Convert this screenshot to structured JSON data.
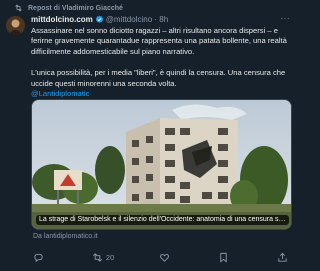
{
  "repost": {
    "icon": "repost-icon",
    "text": "Repost di Vladimiro Giacché"
  },
  "author": {
    "display_name": "mittdolcino.com",
    "verified_icon": "verified-badge-icon",
    "handle_time": "@mittdolcino · 8h"
  },
  "tweet": {
    "paragraph1": "Assassinare nel sonno diciotto ragazzi – altri risultano ancora dispersi – e ferirne gravemente quarantadue rappresenta una patata bollente, una realtà difficilmente addomesticabile sul piano narrativo.",
    "paragraph2": "L'unica possibilità, per i media \"liberi\", è quindi la censura. Una censura che uccide questi minorenni una seconda volta.",
    "mention": "@Lantidiplomatic"
  },
  "card": {
    "headline": "La strage di Starobelsk e il silenzio dell'Occidente: anatomia di una censura sel...",
    "source": "Da lantidiplomatico.it"
  },
  "actions": {
    "reply_icon": "reply-icon",
    "retweet_icon": "retweet-icon",
    "retweet_count": "20",
    "like_icon": "heart-icon",
    "bookmark_icon": "bookmark-icon",
    "share_icon": "share-icon"
  },
  "colors": {
    "background": "#15202b",
    "accent": "#1d9bf0",
    "muted": "#8b98a5"
  }
}
